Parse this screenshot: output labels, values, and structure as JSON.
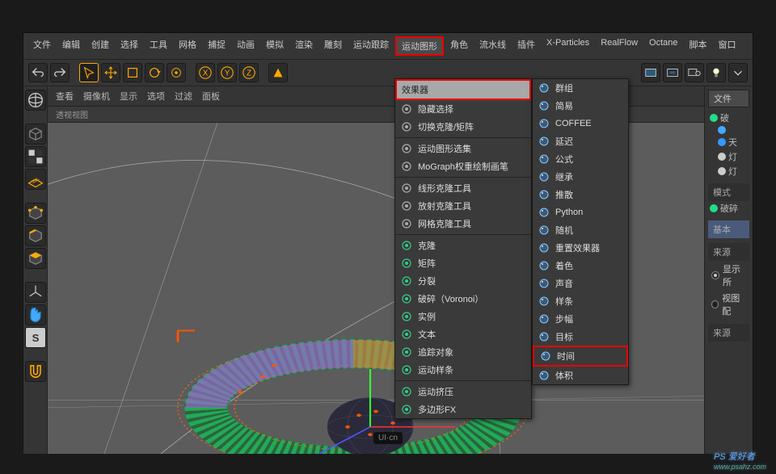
{
  "menubar": [
    "文件",
    "编辑",
    "创建",
    "选择",
    "工具",
    "网格",
    "捕捉",
    "动画",
    "模拟",
    "渲染",
    "雕刻",
    "运动跟踪",
    "运动图形",
    "角色",
    "流水线",
    "插件",
    "X-Particles",
    "RealFlow",
    "Octane",
    "脚本",
    "窗口"
  ],
  "menubar_highlight": 12,
  "vp_menu": [
    "查看",
    "摄像机",
    "显示",
    "选项",
    "过滤",
    "面板"
  ],
  "vp_title": "透视视图",
  "files_tab": "文件",
  "tree": [
    {
      "label": "破",
      "color": "#2d8"
    },
    {
      "label": "",
      "color": "#4af",
      "indent": 1
    },
    {
      "label": "天",
      "color": "#39f",
      "indent": 1
    },
    {
      "label": "灯",
      "color": "#ccc",
      "indent": 1
    },
    {
      "label": "灯",
      "color": "#ccc",
      "indent": 1
    }
  ],
  "mode_label": "模式",
  "mode_item": "破碎",
  "basic_tab": "基本",
  "source_label": "来源",
  "radio1": "显示所",
  "radio2": "视图配",
  "source_label2": "来源",
  "dropdown1_header": "效果器",
  "dropdown1": [
    {
      "label": "隐藏选择",
      "icon": "eye"
    },
    {
      "label": "切换克隆/矩阵",
      "icon": "swap"
    },
    {
      "sep": true
    },
    {
      "label": "运动图形选集",
      "icon": "dots"
    },
    {
      "label": "MoGraph权重绘制画笔",
      "icon": "brush"
    },
    {
      "sep": true
    },
    {
      "label": "线形克隆工具",
      "icon": "line"
    },
    {
      "label": "放射克隆工具",
      "icon": "radial"
    },
    {
      "label": "网格克隆工具",
      "icon": "grid"
    },
    {
      "sep": true
    },
    {
      "label": "克隆",
      "icon": "clone",
      "col": "#3c8"
    },
    {
      "label": "矩阵",
      "icon": "matrix",
      "col": "#3c8"
    },
    {
      "label": "分裂",
      "icon": "split",
      "col": "#3c8"
    },
    {
      "label": "破碎（Voronoi）",
      "icon": "voronoi",
      "col": "#3c8"
    },
    {
      "label": "实例",
      "icon": "inst",
      "col": "#3c8"
    },
    {
      "label": "文本",
      "icon": "text",
      "col": "#3c8"
    },
    {
      "label": "追踪对象",
      "icon": "trace",
      "col": "#3c8"
    },
    {
      "label": "运动样条",
      "icon": "spline",
      "col": "#3c8"
    },
    {
      "sep": true
    },
    {
      "label": "运动挤压",
      "icon": "ext",
      "col": "#3c8"
    },
    {
      "label": "多边形FX",
      "icon": "pfx",
      "col": "#3c8"
    }
  ],
  "dropdown2": [
    {
      "label": "群组",
      "icon": "group"
    },
    {
      "label": "简易",
      "icon": "plain"
    },
    {
      "label": "COFFEE",
      "icon": "coffee"
    },
    {
      "label": "延迟",
      "icon": "delay"
    },
    {
      "label": "公式",
      "icon": "formula"
    },
    {
      "label": "继承",
      "icon": "inherit"
    },
    {
      "label": "推散",
      "icon": "push"
    },
    {
      "label": "Python",
      "icon": "python"
    },
    {
      "label": "随机",
      "icon": "random"
    },
    {
      "label": "重置效果器",
      "icon": "reset"
    },
    {
      "label": "着色",
      "icon": "shader"
    },
    {
      "label": "声音",
      "icon": "sound"
    },
    {
      "label": "样条",
      "icon": "spline2"
    },
    {
      "label": "步幅",
      "icon": "step"
    },
    {
      "label": "目标",
      "icon": "target"
    },
    {
      "label": "时间",
      "icon": "time",
      "hl": true
    },
    {
      "label": "体积",
      "icon": "volume"
    }
  ],
  "watermark_main": "PS 爱好者",
  "watermark_sub": "www.psahz.com",
  "uicn": "UI·cn"
}
